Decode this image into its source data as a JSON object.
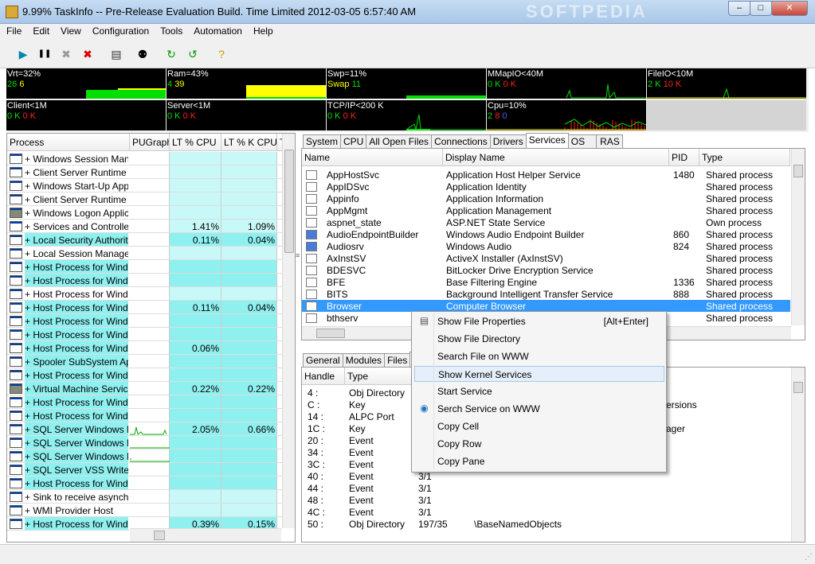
{
  "window": {
    "title": "9.99% TaskInfo -- Pre-Release Evaluation Build. Time Limited   2012-03-05 6:57:40 AM",
    "watermark": "SOFTPEDIA"
  },
  "window_controls": {
    "minimize": "–",
    "maximize": "□",
    "close": "✕"
  },
  "menu": [
    "File",
    "Edit",
    "View",
    "Configuration",
    "Tools",
    "Automation",
    "Help"
  ],
  "toolbar_icons": [
    "play-icon",
    "pause-icon",
    "stop-icon",
    "kill-icon",
    "properties-icon",
    "find-icon",
    "refresh-icon",
    "restart-icon",
    "help-icon"
  ],
  "perf": [
    {
      "l1": "Vrt=32%",
      "a": "26",
      "b": "6",
      "ca": "g",
      "cb": "y"
    },
    {
      "l1": "Ram=43%",
      "a": "4",
      "b": "39",
      "ca": "g",
      "cb": "y"
    },
    {
      "l1": "Swp=11%",
      "a": "Swap",
      "b": "11",
      "ca": "y",
      "cb": "g"
    },
    {
      "l1": "MMapIO<40M",
      "a": "0 K",
      "b": "0 K",
      "ca": "g",
      "cb": "r"
    },
    {
      "l1": "FileIO<10M",
      "a": "2 K",
      "b": "10 K",
      "ca": "g",
      "cb": "r"
    },
    {
      "l1": "Client<1M",
      "a": "0 K",
      "b": "0 K",
      "ca": "g",
      "cb": "r"
    },
    {
      "l1": "Server<1M",
      "a": "0 K",
      "b": "0 K",
      "ca": "g",
      "cb": "r"
    },
    {
      "l1": "TCP/IP<200 K",
      "a": "0 K",
      "b": "0 K",
      "ca": "g",
      "cb": "r"
    },
    {
      "l1": "Cpu=10%",
      "a": "2",
      "b": "8",
      "c": "0",
      "ca": "g",
      "cb": "r",
      "cc": "b"
    }
  ],
  "process_headers": [
    "Process",
    "PUGraph",
    "LT % CPU",
    "LT % K CPU",
    "T"
  ],
  "processes": [
    {
      "name": "+ Windows Session Mana",
      "cpu": "",
      "kcpu": "",
      "hl": ""
    },
    {
      "name": "+ Client Server Runtime P",
      "cpu": "",
      "kcpu": "",
      "hl": ""
    },
    {
      "name": "+ Windows Start-Up Appli",
      "cpu": "",
      "kcpu": "",
      "hl": ""
    },
    {
      "name": "+ Client Server Runtime P",
      "cpu": "",
      "kcpu": "",
      "hl": ""
    },
    {
      "name": "+ Windows Logon Applica",
      "cpu": "",
      "kcpu": "",
      "hl": ""
    },
    {
      "name": "+ Services and Controller",
      "cpu": "1.41%",
      "kcpu": "1.09%",
      "hl": ""
    },
    {
      "name": "+ Local Security Authority",
      "cpu": "0.11%",
      "kcpu": "0.04%",
      "hl": "cyan"
    },
    {
      "name": "+ Local Session Manager",
      "cpu": "",
      "kcpu": "",
      "hl": ""
    },
    {
      "name": "+ Host Process for Windo",
      "cpu": "",
      "kcpu": "",
      "hl": "cyan"
    },
    {
      "name": "+ Host Process for Windo",
      "cpu": "",
      "kcpu": "",
      "hl": "cyan"
    },
    {
      "name": "+ Host Process for Windo",
      "cpu": "",
      "kcpu": "",
      "hl": ""
    },
    {
      "name": "+ Host Process for Windo",
      "cpu": "0.11%",
      "kcpu": "0.04%",
      "hl": "cyan"
    },
    {
      "name": "+ Host Process for Windo",
      "cpu": "",
      "kcpu": "",
      "hl": "cyan"
    },
    {
      "name": "+ Host Process for Windo",
      "cpu": "",
      "kcpu": "",
      "hl": "cyan"
    },
    {
      "name": "+ Host Process for Windo",
      "cpu": "0.06%",
      "kcpu": "",
      "hl": "cyan"
    },
    {
      "name": "+ Spooler SubSystem App",
      "cpu": "",
      "kcpu": "",
      "hl": "cyan"
    },
    {
      "name": "+ Host Process for Windo",
      "cpu": "",
      "kcpu": "",
      "hl": "cyan"
    },
    {
      "name": "+ Virtual Machine Service",
      "cpu": "0.22%",
      "kcpu": "0.22%",
      "hl": "cyan"
    },
    {
      "name": "+ Host Process for Windo",
      "cpu": "",
      "kcpu": "",
      "hl": "cyan"
    },
    {
      "name": "+ Host Process for Windo",
      "cpu": "",
      "kcpu": "",
      "hl": "cyan"
    },
    {
      "name": "+ SQL Server Windows N",
      "cpu": "2.05%",
      "kcpu": "0.66%",
      "hl": "cyan"
    },
    {
      "name": "+ SQL Server Windows N",
      "cpu": "",
      "kcpu": "",
      "hl": "cyan"
    },
    {
      "name": "+ SQL Server Windows N",
      "cpu": "",
      "kcpu": "",
      "hl": "cyan"
    },
    {
      "name": "+ SQL Server VSS Writer",
      "cpu": "",
      "kcpu": "",
      "hl": "cyan"
    },
    {
      "name": "+ Host Process for Windo",
      "cpu": "",
      "kcpu": "",
      "hl": "cyan"
    },
    {
      "name": "+ Sink to receive asynchr",
      "cpu": "",
      "kcpu": "",
      "hl": ""
    },
    {
      "name": "+ WMI Provider Host",
      "cpu": "",
      "kcpu": "",
      "hl": ""
    },
    {
      "name": "+ Host Process for Windo",
      "cpu": "0.39%",
      "kcpu": "0.15%",
      "hl": "cyan"
    }
  ],
  "top_tabs": [
    "System",
    "CPU",
    "All Open Files",
    "Connections",
    "Drivers",
    "Services",
    "OS",
    "RAS"
  ],
  "service_headers": [
    "Name",
    "Display Name",
    "PID",
    "Type"
  ],
  "services": [
    {
      "name": "AppHostSvc",
      "display": "Application Host Helper Service",
      "pid": "1480",
      "type": "Shared process"
    },
    {
      "name": "AppIDSvc",
      "display": "Application Identity",
      "pid": "",
      "type": "Shared process"
    },
    {
      "name": "Appinfo",
      "display": "Application Information",
      "pid": "",
      "type": "Shared process"
    },
    {
      "name": "AppMgmt",
      "display": "Application Management",
      "pid": "",
      "type": "Shared process"
    },
    {
      "name": "aspnet_state",
      "display": "ASP.NET State Service",
      "pid": "",
      "type": "Own process"
    },
    {
      "name": "AudioEndpointBuilder",
      "display": "Windows Audio Endpoint Builder",
      "pid": "860",
      "type": "Shared process"
    },
    {
      "name": "Audiosrv",
      "display": "Windows Audio",
      "pid": "824",
      "type": "Shared process"
    },
    {
      "name": "AxInstSV",
      "display": "ActiveX Installer (AxInstSV)",
      "pid": "",
      "type": "Shared process"
    },
    {
      "name": "BDESVC",
      "display": "BitLocker Drive Encryption Service",
      "pid": "",
      "type": "Shared process"
    },
    {
      "name": "BFE",
      "display": "Base Filtering Engine",
      "pid": "1336",
      "type": "Shared process"
    },
    {
      "name": "BITS",
      "display": "Background Intelligent Transfer Service",
      "pid": "888",
      "type": "Shared process"
    },
    {
      "name": "Browser",
      "display": "Computer Browser",
      "pid": "",
      "type": "Shared process"
    },
    {
      "name": "bthserv",
      "display": "",
      "pid": "",
      "type": "Shared process"
    }
  ],
  "bottom_tabs": [
    "General",
    "Modules",
    "Files",
    "H"
  ],
  "handle_headers": [
    "Handle",
    "Type"
  ],
  "handles": [
    {
      "h": "4 :",
      "t": "Obj Directory",
      "c": "",
      "d": ""
    },
    {
      "h": "C :",
      "t": "Key",
      "c": "",
      "d": "ersions"
    },
    {
      "h": "14 :",
      "t": "ALPC Port",
      "c": "",
      "d": ""
    },
    {
      "h": "1C :",
      "t": "Key",
      "c": "",
      "d": "ager"
    },
    {
      "h": "20 :",
      "t": "Event",
      "c": "",
      "d": ""
    },
    {
      "h": "34 :",
      "t": "Event",
      "c": "",
      "d": ""
    },
    {
      "h": "3C :",
      "t": "Event",
      "c": "",
      "d": ""
    },
    {
      "h": "40 :",
      "t": "Event",
      "c": "3/1",
      "d": ""
    },
    {
      "h": "44 :",
      "t": "Event",
      "c": "3/1",
      "d": ""
    },
    {
      "h": "48 :",
      "t": "Event",
      "c": "3/1",
      "d": ""
    },
    {
      "h": "4C :",
      "t": "Event",
      "c": "3/1",
      "d": ""
    },
    {
      "h": "50 :",
      "t": "Obj Directory",
      "c": "197/35",
      "d": "\\BaseNamedObjects"
    }
  ],
  "context_menu": [
    {
      "label": "Show File Properties",
      "shortcut": "[Alt+Enter]",
      "icon": "properties-icon"
    },
    {
      "label": "Show File Directory",
      "shortcut": "",
      "icon": ""
    },
    {
      "label": "Search File on WWW",
      "shortcut": "",
      "icon": ""
    },
    {
      "label": "Show Kernel Services",
      "shortcut": "",
      "icon": ""
    },
    {
      "label": "Start Service",
      "shortcut": "",
      "icon": ""
    },
    {
      "label": "Serch Service on WWW",
      "shortcut": "",
      "icon": "globe-icon"
    },
    {
      "label": "Copy Cell",
      "shortcut": "",
      "icon": ""
    },
    {
      "label": "Copy Row",
      "shortcut": "",
      "icon": ""
    },
    {
      "label": "Copy Pane",
      "shortcut": "",
      "icon": ""
    }
  ],
  "colors": {
    "selection": "#3399ff",
    "highlight_row": "#8ff0f0",
    "graph_green": "#00e000",
    "graph_yellow": "#ffff00"
  }
}
